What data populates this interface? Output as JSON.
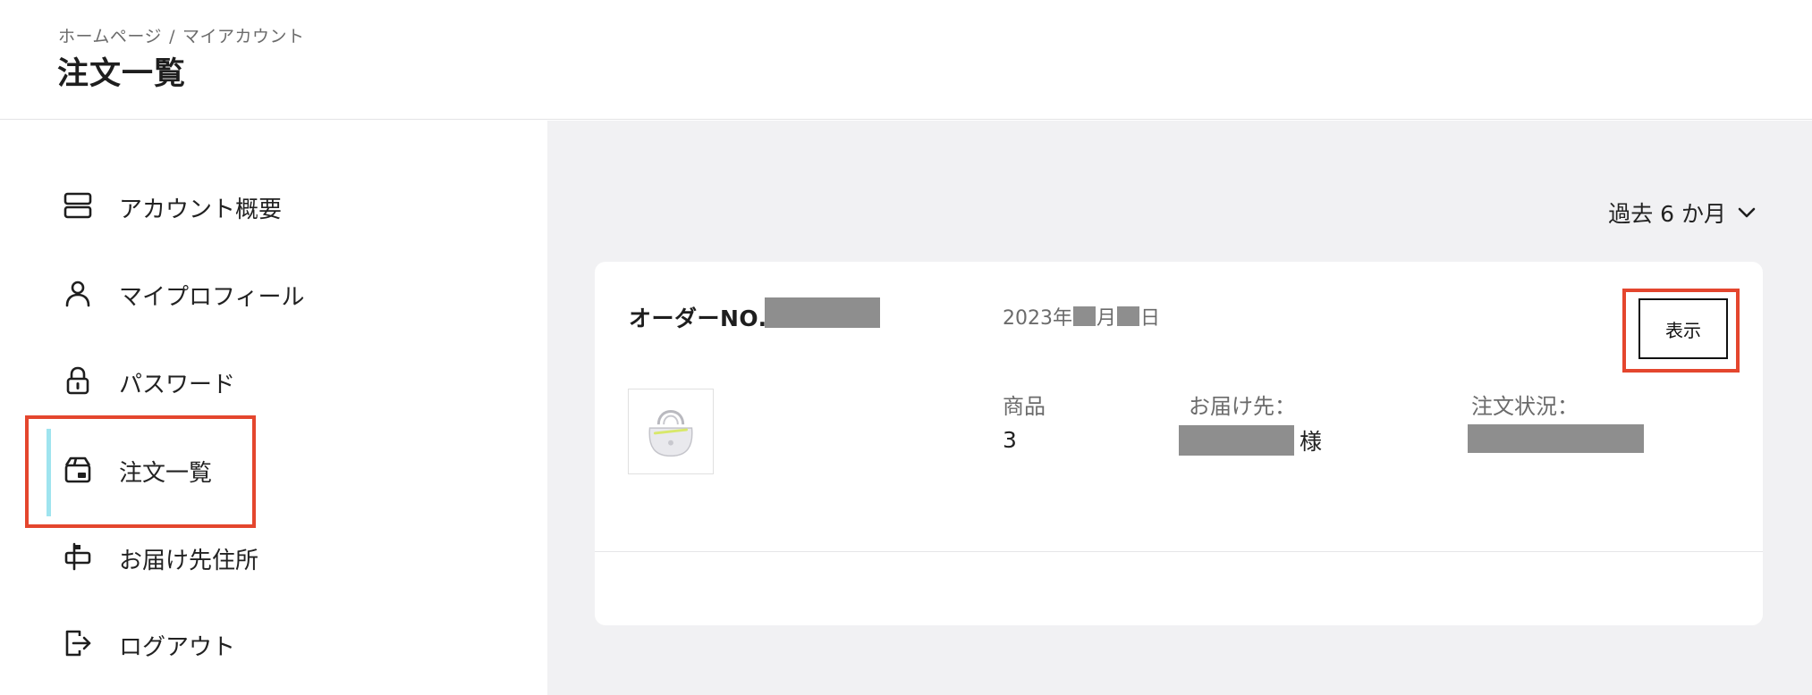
{
  "header": {
    "breadcrumb": [
      "ホームページ",
      "マイアカウント"
    ],
    "breadcrumb_separator": "/",
    "title": "注文一覧"
  },
  "sidebar": {
    "items": [
      {
        "label": "アカウント概要",
        "icon": "account-summary-icon",
        "active": false
      },
      {
        "label": "マイプロフィール",
        "icon": "user-icon",
        "active": false
      },
      {
        "label": "パスワード",
        "icon": "lock-icon",
        "active": false
      },
      {
        "label": "注文一覧",
        "icon": "order-box-icon",
        "active": true
      },
      {
        "label": "お届け先住所",
        "icon": "mailbox-icon",
        "active": false
      },
      {
        "label": "ログアウト",
        "icon": "logout-icon",
        "active": false
      }
    ],
    "active_color": "#9fe4ef"
  },
  "main": {
    "period_filter": "過去 6 か月",
    "order": {
      "order_label": "オーダーNO.",
      "date_parts": [
        "2023年",
        "月",
        "日"
      ],
      "view_button": "表示",
      "product_label": "商品",
      "product_count": "3",
      "recipient_label": "お届け先：",
      "recipient_suffix": "様",
      "status_label": "注文状況："
    }
  },
  "colors": {
    "highlight": "#e4462e",
    "content_bg": "#f1f1f3",
    "redaction": "#8e8e8e"
  }
}
